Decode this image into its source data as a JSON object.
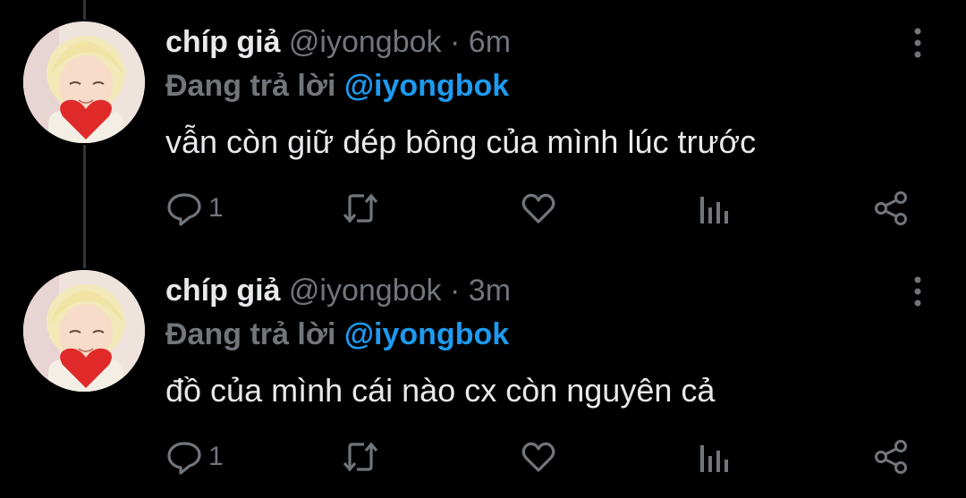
{
  "colors": {
    "background": "#000000",
    "text": "#e7e9ea",
    "secondary": "#71767b",
    "mention": "#1d9bf0",
    "thread_line": "#333639"
  },
  "tweets": [
    {
      "display_name": "chíp giả",
      "handle": "@iyongbok",
      "separator": "·",
      "time": "6m",
      "replying_label": "Đang trả lời",
      "replying_to": "@iyongbok",
      "text": "vẫn còn giữ dép bông của mình lúc trước",
      "reply_count": "1",
      "icons": [
        "reply-icon",
        "retweet-icon",
        "like-icon",
        "analytics-icon",
        "share-icon",
        "more-icon"
      ]
    },
    {
      "display_name": "chíp giả",
      "handle": "@iyongbok",
      "separator": "·",
      "time": "3m",
      "replying_label": "Đang trả lời",
      "replying_to": "@iyongbok",
      "text": "đồ của mình cái nào cx còn nguyên cả",
      "reply_count": "1",
      "icons": [
        "reply-icon",
        "retweet-icon",
        "like-icon",
        "analytics-icon",
        "share-icon",
        "more-icon"
      ]
    }
  ]
}
